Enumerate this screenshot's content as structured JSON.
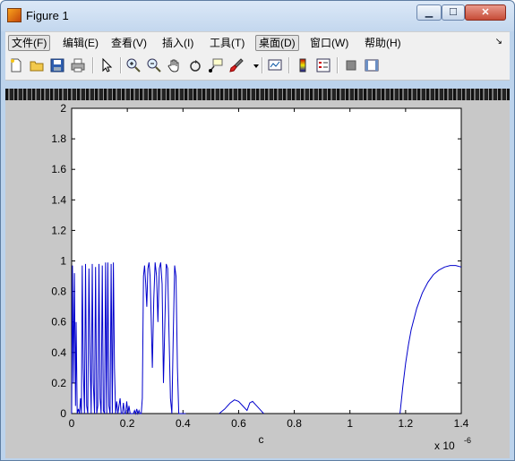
{
  "window": {
    "title": "Figure 1",
    "min_label": "▁",
    "max_label": "☐",
    "close_label": "✕"
  },
  "menu": [
    {
      "label": "文件(F)",
      "active": true
    },
    {
      "label": "编辑(E)"
    },
    {
      "label": "查看(V)"
    },
    {
      "label": "插入(I)"
    },
    {
      "label": "工具(T)"
    },
    {
      "label": "桌面(D)",
      "active": true
    },
    {
      "label": "窗口(W)"
    },
    {
      "label": "帮助(H)"
    }
  ],
  "toolbar_icons": [
    "new-figure-icon",
    "open-file-icon",
    "save-icon",
    "print-icon",
    "pointer-icon",
    "zoom-in-icon",
    "zoom-out-icon",
    "pan-hand-icon",
    "rotate-3d-icon",
    "data-cursor-icon",
    "brush-icon",
    "brush-dropdown-icon",
    "link-plot-icon",
    "colorbar-icon",
    "legend-icon",
    "hide-plot-tools-icon",
    "show-plot-tools-icon"
  ],
  "chart_data": {
    "type": "line",
    "xlabel": "c",
    "x_multiplier": "x 10",
    "x_exponent": "-6",
    "xlim": [
      0,
      1.4
    ],
    "ylim": [
      0,
      2
    ],
    "xticks": [
      "0",
      "0.2",
      "0.4",
      "0.6",
      "0.8",
      "1",
      "1.2",
      "1.4"
    ],
    "yticks": [
      "0",
      "0.2",
      "0.4",
      "0.6",
      "0.8",
      "1",
      "1.2",
      "1.4",
      "1.6",
      "1.8",
      "2"
    ],
    "line_color": "#0000cc",
    "grid": false,
    "series": [
      {
        "x": [
          0.0,
          0.003,
          0.006,
          0.01,
          0.014,
          0.016,
          0.02,
          0.024,
          0.028,
          0.032,
          0.035,
          0.038,
          0.042,
          0.046,
          0.05,
          0.054,
          0.058,
          0.062,
          0.066,
          0.07,
          0.074,
          0.078,
          0.082,
          0.086,
          0.09,
          0.094,
          0.098,
          0.102,
          0.106,
          0.11,
          0.114,
          0.118,
          0.122,
          0.126,
          0.13,
          0.134,
          0.138,
          0.142,
          0.146,
          0.15,
          0.154,
          0.158,
          0.162,
          0.166,
          0.17,
          0.174,
          0.178,
          0.182,
          0.186,
          0.19,
          0.194,
          0.198,
          0.202,
          0.206,
          0.21,
          0.214,
          0.218,
          0.222,
          0.226,
          0.23,
          0.234,
          0.238,
          0.242,
          0.246,
          0.25,
          0.254,
          0.258,
          0.262,
          0.266,
          0.27,
          0.274,
          0.278,
          0.282,
          0.286,
          0.29,
          0.295,
          0.3,
          0.305,
          0.31,
          0.315,
          0.32,
          0.325,
          0.33,
          0.335,
          0.34,
          0.345,
          0.35,
          0.355,
          0.36,
          0.365,
          0.37,
          0.375,
          0.38,
          0.385,
          0.39,
          0.395,
          0.4,
          0.405,
          0.41
        ],
        "y": [
          0.0,
          0.97,
          0.2,
          0.92,
          0.05,
          0.6,
          0.0,
          0.03,
          0.0,
          0.1,
          0.0,
          0.97,
          0.3,
          0.0,
          0.98,
          0.05,
          0.0,
          0.95,
          0.4,
          0.0,
          0.98,
          0.2,
          0.0,
          0.96,
          0.0,
          0.05,
          0.98,
          0.1,
          0.0,
          0.97,
          0.02,
          0.0,
          0.99,
          0.0,
          0.99,
          0.05,
          0.0,
          0.98,
          0.0,
          0.99,
          0.3,
          0.0,
          0.08,
          0.0,
          0.05,
          0.1,
          0.0,
          0.0,
          0.07,
          0.0,
          0.0,
          0.08,
          0.0,
          0.05,
          0.0,
          0.0,
          0.0,
          0.0,
          0.02,
          0.0,
          0.03,
          0.0,
          0.02,
          0.0,
          0.0,
          0.1,
          0.9,
          0.97,
          0.85,
          0.7,
          0.95,
          0.99,
          0.9,
          0.6,
          0.3,
          0.75,
          0.99,
          0.9,
          0.6,
          0.95,
          0.99,
          0.85,
          0.2,
          0.6,
          0.98,
          0.95,
          0.5,
          0.1,
          0.0,
          0.5,
          0.97,
          0.9,
          0.3,
          0.0,
          0.0,
          0.0,
          0.0,
          0.0,
          0.0
        ]
      },
      {
        "x": [
          0.53,
          0.55,
          0.57,
          0.585,
          0.6,
          0.615,
          0.63,
          0.64,
          0.65,
          0.66,
          0.67,
          0.68,
          0.69
        ],
        "y": [
          0.0,
          0.03,
          0.07,
          0.09,
          0.08,
          0.05,
          0.02,
          0.07,
          0.08,
          0.06,
          0.04,
          0.02,
          0.0
        ]
      },
      {
        "x": [
          1.18,
          1.19,
          1.2,
          1.21,
          1.22,
          1.24,
          1.26,
          1.28,
          1.3,
          1.32,
          1.34,
          1.36,
          1.38,
          1.4
        ],
        "y": [
          0.0,
          0.18,
          0.33,
          0.45,
          0.55,
          0.69,
          0.79,
          0.86,
          0.91,
          0.94,
          0.96,
          0.97,
          0.97,
          0.96
        ]
      }
    ]
  }
}
